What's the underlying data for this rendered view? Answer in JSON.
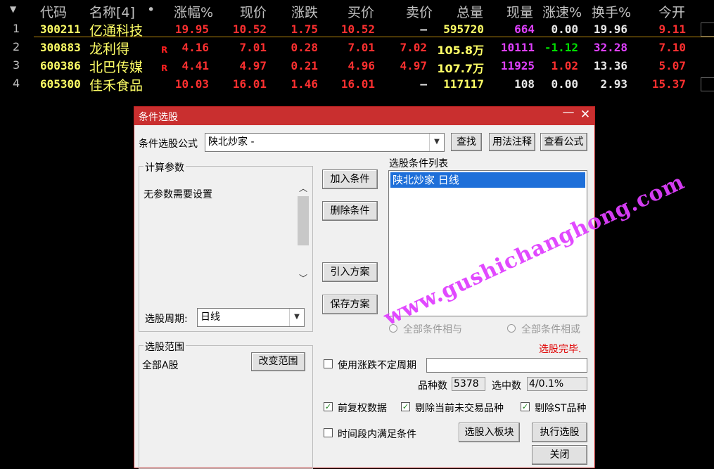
{
  "table": {
    "headers": [
      "代码",
      "名称[4]",
      "•",
      "涨幅%",
      "现价",
      "涨跌",
      "买价",
      "卖价",
      "总量",
      "现量",
      "涨速%",
      "换手%",
      "今开"
    ],
    "rows": [
      {
        "idx": "1",
        "code": "300211",
        "name": "亿通科技",
        "tag": "",
        "pct": "19.95",
        "price": "10.52",
        "chg": "1.75",
        "bid": "10.52",
        "ask": "—",
        "vol": "595720",
        "cur": "664",
        "speed": "0.00",
        "turn": "19.96",
        "open": "9.11"
      },
      {
        "idx": "2",
        "code": "300883",
        "name": "龙利得",
        "tag": "R",
        "pct": "4.16",
        "price": "7.01",
        "chg": "0.28",
        "bid": "7.01",
        "ask": "7.02",
        "vol": "105.8万",
        "cur": "10111",
        "speed": "-1.12",
        "turn": "32.28",
        "open": "7.10"
      },
      {
        "idx": "3",
        "code": "600386",
        "name": "北巴传媒",
        "tag": "R",
        "pct": "4.41",
        "price": "4.97",
        "chg": "0.21",
        "bid": "4.96",
        "ask": "4.97",
        "vol": "107.7万",
        "cur": "11925",
        "speed": "1.02",
        "turn": "13.36",
        "open": "5.07"
      },
      {
        "idx": "4",
        "code": "605300",
        "name": "佳禾食品",
        "tag": "",
        "pct": "10.03",
        "price": "16.01",
        "chg": "1.46",
        "bid": "16.01",
        "ask": "—",
        "vol": "117117",
        "cur": "108",
        "speed": "0.00",
        "turn": "2.93",
        "open": "15.37"
      }
    ]
  },
  "dialog": {
    "title": "条件选股",
    "formula_label": "条件选股公式",
    "formula_value": "陕北炒家  -",
    "btn_find": "查找",
    "btn_usage": "用法注释",
    "btn_view": "查看公式",
    "params_group": "计算参数",
    "params_text": "无参数需要设置",
    "period_label": "选股周期:",
    "period_value": "日线",
    "btn_add": "加入条件",
    "btn_delete": "删除条件",
    "btn_import": "引入方案",
    "btn_save": "保存方案",
    "cond_list_label": "选股条件列表",
    "cond_items": [
      "陕北炒家  日线"
    ],
    "radio_and": "全部条件相与",
    "radio_or": "全部条件相或",
    "status": "选股完毕.",
    "range_group": "选股范围",
    "range_value": "全部A股",
    "btn_change_range": "改变范围",
    "chk_uncertain": "使用涨跌不定周期",
    "count_label": "品种数",
    "count_value": "5378",
    "selected_label": "选中数",
    "selected_value": "4/0.1%",
    "chk_adjusted": "前复权数据",
    "chk_exclude_suspended": "剔除当前未交易品种",
    "chk_exclude_st": "剔除ST品种",
    "chk_timeperiod": "时间段内满足条件",
    "btn_to_block": "选股入板块",
    "btn_execute": "执行选股",
    "btn_close": "关闭"
  },
  "watermark": "www.gushichanghong.com",
  "colors": {
    "up": "#ff3030",
    "down": "#00e000",
    "neutral": "#e8e8e8",
    "code": "#ffff66",
    "magenta": "#e040ff",
    "titlebar": "#c92f2f"
  }
}
